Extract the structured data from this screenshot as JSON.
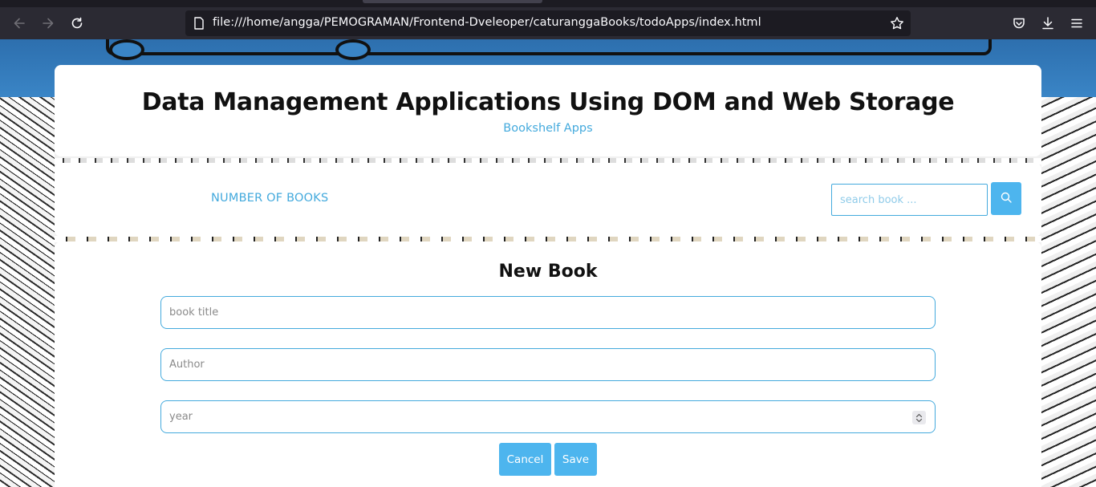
{
  "browser": {
    "url": "file:///home/angga/PEMOGRAMAN/Frontend-Dveleoper/caturanggaBooks/todoApps/index.html",
    "icons": [
      "back-arrow-icon",
      "forward-arrow-icon",
      "reload-icon",
      "page-icon",
      "bookmark-star-icon",
      "pocket-icon",
      "download-icon",
      "menu-icon"
    ]
  },
  "header": {
    "title": "Data Management Applications Using DOM and Web Storage",
    "subtitle": "Bookshelf Apps"
  },
  "counter": {
    "label": "NUMBER OF BOOKS"
  },
  "search": {
    "placeholder": "search book ...",
    "icon": "search-icon"
  },
  "form": {
    "title": "New Book",
    "title_placeholder": "book title",
    "author_placeholder": "Author",
    "year_placeholder": "year",
    "cancel_label": "Cancel",
    "save_label": "Save"
  },
  "colors": {
    "accent": "#4db5ee",
    "accent_text": "#44aadd",
    "chrome_bg": "#2b2a33"
  }
}
